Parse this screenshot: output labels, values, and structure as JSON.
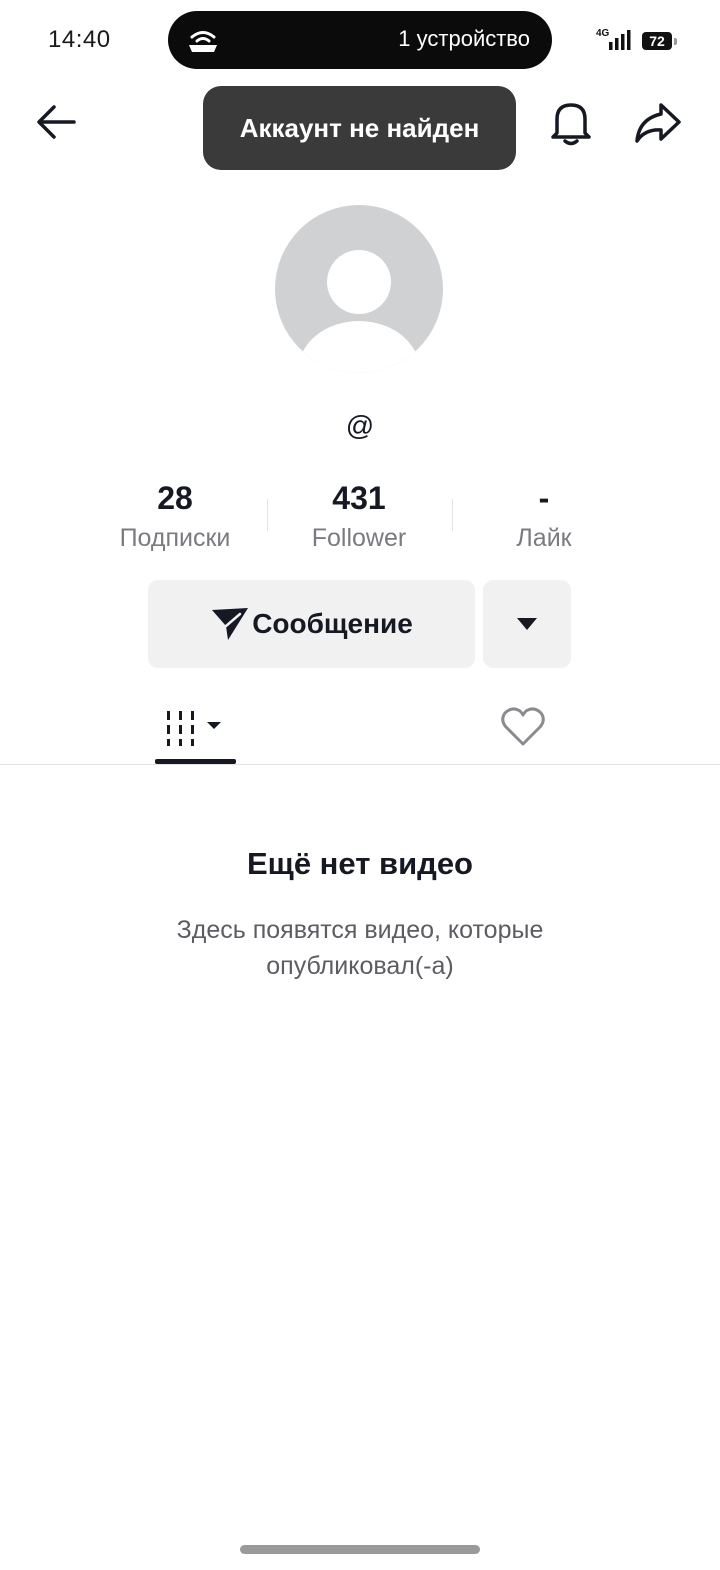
{
  "status_bar": {
    "time": "14:40",
    "island_text": "1 устройство",
    "network": "4G",
    "battery": "72"
  },
  "header": {
    "toast": "Аккаунт не найден"
  },
  "profile": {
    "username": "@"
  },
  "stats": {
    "following": {
      "value": "28",
      "label": "Подписки"
    },
    "followers": {
      "value": "431",
      "label": "Follower"
    },
    "likes": {
      "value": "-",
      "label": "Лайк"
    }
  },
  "actions": {
    "message_label": "Сообщение"
  },
  "empty_state": {
    "title": "Ещё нет видео",
    "description": "Здесь появятся видео, которые опубликовал(-а)"
  },
  "icons": {
    "back": "arrow-left-icon",
    "bell": "bell-icon",
    "share": "share-arrow-icon",
    "send": "paper-plane-icon",
    "dropdown": "caret-down-icon",
    "videos": "grid-icon",
    "liked": "heart-icon"
  }
}
